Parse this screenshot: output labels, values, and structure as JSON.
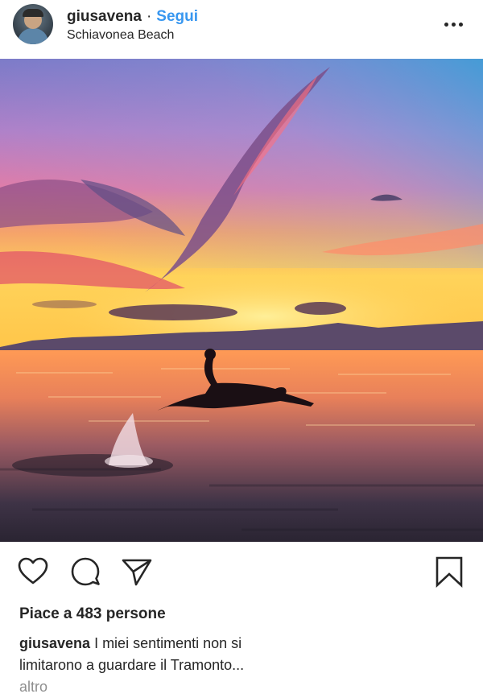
{
  "post": {
    "username": "giusavena",
    "separator": "·",
    "follow_label": "Segui",
    "location": "Schiavonea Beach",
    "more_icon": "more-horizontal-icon"
  },
  "photo": {
    "subject": "Person diving into the sea at sunset"
  },
  "actions": {
    "like_icon": "heart-icon",
    "comment_icon": "comment-icon",
    "share_icon": "send-icon",
    "save_icon": "bookmark-icon"
  },
  "likes_text": "Piace a 483 persone",
  "caption": {
    "username": "giusavena",
    "text": "I miei sentimenti non si limitarono a guardare il Tramonto...",
    "more_label": "altro"
  },
  "colors": {
    "link_blue": "#3897f0",
    "text_dark": "#262626",
    "text_muted": "#8e8e8e"
  }
}
